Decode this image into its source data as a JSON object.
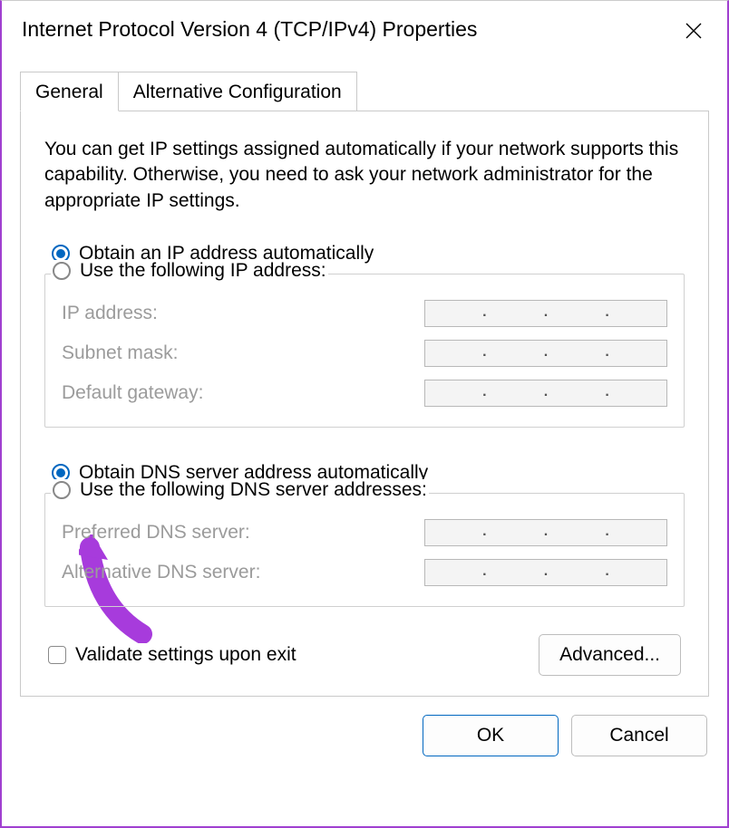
{
  "window": {
    "title": "Internet Protocol Version 4 (TCP/IPv4) Properties"
  },
  "tabs": {
    "general": "General",
    "alt": "Alternative Configuration"
  },
  "intro": "You can get IP settings assigned automatically if your network supports this capability. Otherwise, you need to ask your network administrator for the appropriate IP settings.",
  "ip": {
    "auto_label": "Obtain an IP address automatically",
    "manual_label": "Use the following IP address:",
    "selected": "auto",
    "fields": {
      "ip_address": "IP address:",
      "subnet": "Subnet mask:",
      "gateway": "Default gateway:"
    },
    "values": {
      "ip_address": "",
      "subnet": "",
      "gateway": ""
    }
  },
  "dns": {
    "auto_label": "Obtain DNS server address automatically",
    "manual_label": "Use the following DNS server addresses:",
    "selected": "auto",
    "fields": {
      "preferred": "Preferred DNS server:",
      "alt": "Alternative DNS server:"
    },
    "values": {
      "preferred": "",
      "alt": ""
    }
  },
  "validate": {
    "label": "Validate settings upon exit",
    "checked": false
  },
  "buttons": {
    "advanced": "Advanced...",
    "ok": "OK",
    "cancel": "Cancel"
  }
}
